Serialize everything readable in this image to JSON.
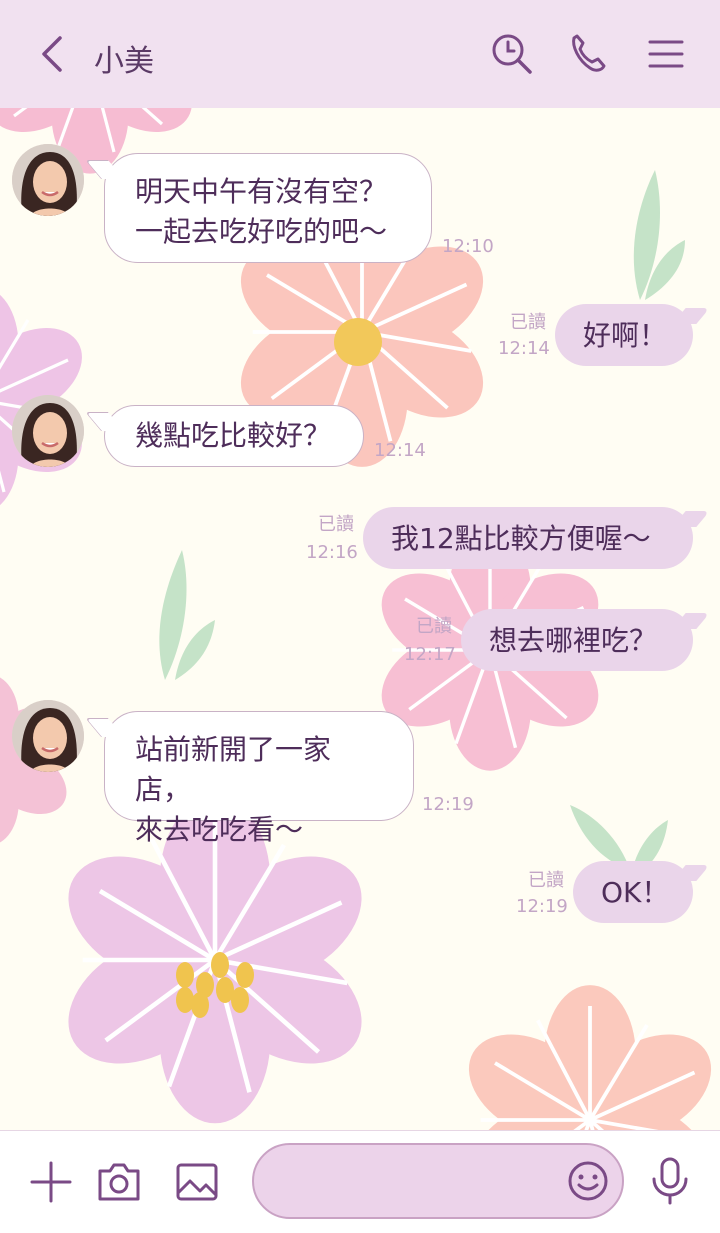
{
  "header": {
    "title": "小美"
  },
  "messages": [
    {
      "side": "in",
      "text": "明天中午有沒有空？\n一起去吃好吃的吧～",
      "time": "12:10"
    },
    {
      "side": "out",
      "text": "好啊！",
      "read": "已讀",
      "time": "12:14"
    },
    {
      "side": "in",
      "text": "幾點吃比較好？",
      "time": "12:14"
    },
    {
      "side": "out",
      "text": "我12點比較方便喔～",
      "read": "已讀",
      "time": "12:16"
    },
    {
      "side": "out",
      "text": "想去哪裡吃？",
      "read": "已讀",
      "time": "12:17"
    },
    {
      "side": "in",
      "text": "站前新開了一家店，\n來去吃吃看～",
      "time": "12:19"
    },
    {
      "side": "out",
      "text": "OK！",
      "read": "已讀",
      "time": "12:19"
    }
  ],
  "composer": {
    "placeholder": ""
  },
  "icons": {
    "back": "chevron-left-icon",
    "search": "search-clock-icon",
    "call": "phone-icon",
    "menu": "hamburger-menu-icon",
    "add": "plus-icon",
    "camera": "camera-icon",
    "image": "image-icon",
    "emoji": "smiley-icon",
    "mic": "microphone-icon"
  },
  "colors": {
    "header_bg": "#f1e1f0",
    "accent": "#7a4a86",
    "outgoing_bubble": "#ead5ea",
    "incoming_bubble": "#ffffff",
    "background": "#fffdf3"
  }
}
